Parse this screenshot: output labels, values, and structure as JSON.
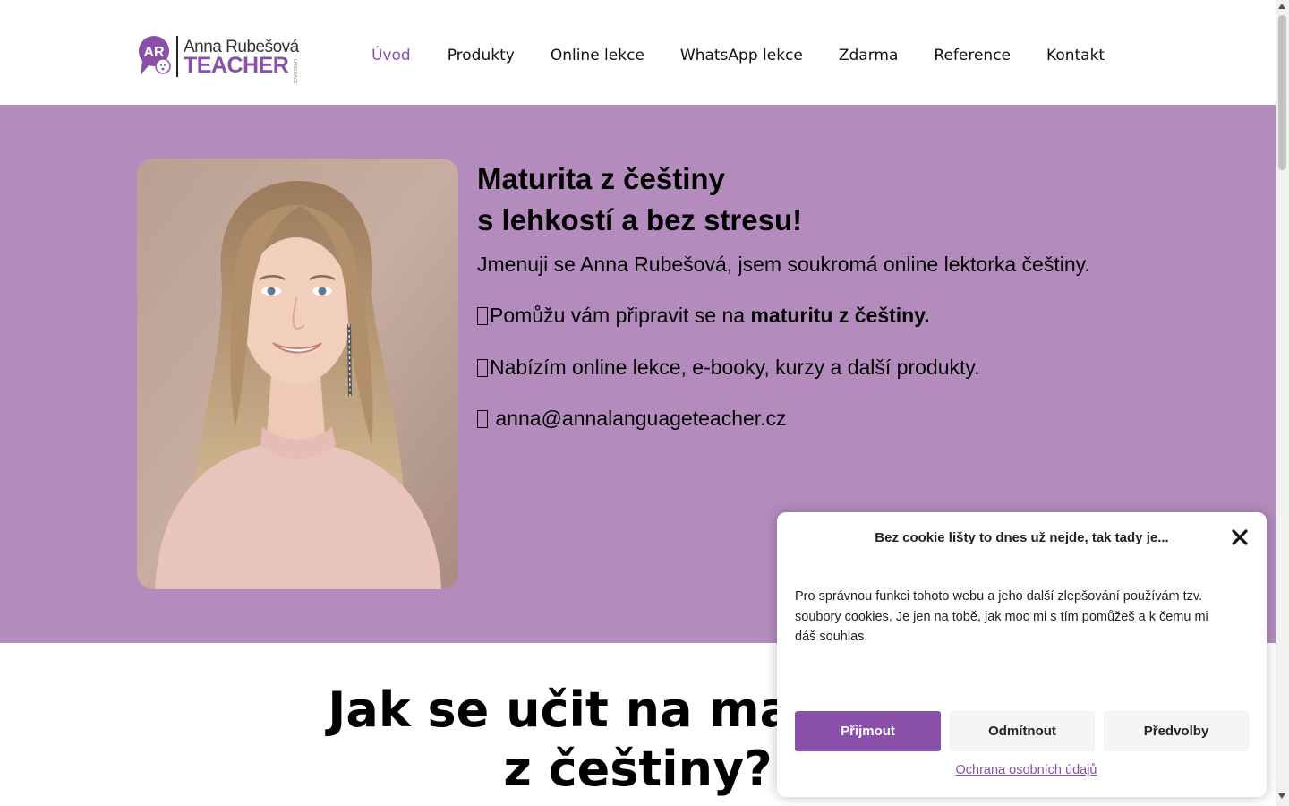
{
  "header": {
    "logo": {
      "initials": "AR",
      "name": "Anna Rubešová",
      "teacher": "TEACHER",
      "small": "LANGUAGE"
    },
    "nav": [
      {
        "label": "Úvod",
        "active": true
      },
      {
        "label": "Produkty",
        "active": false
      },
      {
        "label": "Online lekce",
        "active": false
      },
      {
        "label": "WhatsApp lekce",
        "active": false
      },
      {
        "label": "Zdarma",
        "active": false
      },
      {
        "label": "Reference",
        "active": false
      },
      {
        "label": "Kontakt",
        "active": false
      }
    ]
  },
  "hero": {
    "title_line1": "Maturita z češtiny",
    "title_line2": "s lehkostí a bez stresu!",
    "intro": "Jmenuji se Anna Rubešová, jsem soukromá online lektorka češtiny.",
    "line2_prefix": "Pomůžu vám připravit se na ",
    "line2_bold": "maturitu z češtiny.",
    "line3": "Nabízím online lekce, e-booky, kurzy a další produkty.",
    "email": " anna@annalanguageteacher.cz",
    "background": "#b38cbd"
  },
  "section": {
    "title_line1": "Jak se učit na maturitu",
    "title_line2": "z češtiny?"
  },
  "cookie": {
    "title": "Bez cookie lišty to dnes už nejde, tak tady je...",
    "text": "Pro správnou funkci tohoto webu a jeho další zlepšování používám tzv. soubory cookies. Je jen na tobě, jak moc mi s tím pomůžeš a k čemu mi dáš souhlas.",
    "accept": "Přijmout",
    "deny": "Odmítnout",
    "prefs": "Předvolby",
    "privacy_link": "Ochrana osobních údajů"
  },
  "colors": {
    "accent": "#8a4fa8",
    "hero_bg": "#b38cbd"
  },
  "icons": [
    "close-icon",
    "emoji-placeholder-icon"
  ]
}
